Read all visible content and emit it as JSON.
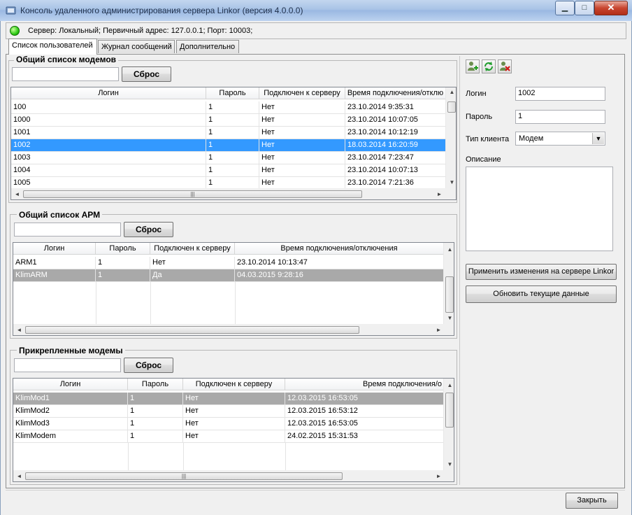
{
  "window": {
    "title": "Консоль удаленного администрирования сервера Linkor (версия 4.0.0.0)",
    "minimize": "▁",
    "maximize": "□",
    "close": "✕"
  },
  "status": {
    "text": "Сервер: Локальный; Первичный адрес: 127.0.0.1; Порт: 10003;",
    "led_color": "#2ecb16"
  },
  "tabs": [
    {
      "label": "Список пользователей",
      "active": true
    },
    {
      "label": "Журнал сообщений",
      "active": false
    },
    {
      "label": "Дополнительно",
      "active": false
    }
  ],
  "modems": {
    "title": "Общий список модемов",
    "filter_value": "",
    "reset_label": "Сброс",
    "columns": [
      "Логин",
      "Пароль",
      "Подключен к серверу",
      "Время подключения/отклю"
    ],
    "rows": [
      [
        "100",
        "1",
        "Нет",
        "23.10.2014 9:35:31"
      ],
      [
        "1000",
        "1",
        "Нет",
        "23.10.2014 10:07:05"
      ],
      [
        "1001",
        "1",
        "Нет",
        "23.10.2014 10:12:19"
      ],
      [
        "1002",
        "1",
        "Нет",
        "18.03.2014 16:20:59"
      ],
      [
        "1003",
        "1",
        "Нет",
        "23.10.2014 7:23:47"
      ],
      [
        "1004",
        "1",
        "Нет",
        "23.10.2014 10:07:13"
      ],
      [
        "1005",
        "1",
        "Нет",
        "23.10.2014 7:21:36"
      ]
    ],
    "selected_index": 3
  },
  "arm": {
    "title": "Общий список АРМ",
    "filter_value": "",
    "reset_label": "Сброс",
    "columns": [
      "Логин",
      "Пароль",
      "Подключен к серверу",
      "Время подключения/отключения"
    ],
    "rows": [
      [
        "ARM1",
        "1",
        "Нет",
        "23.10.2014 10:13:47"
      ],
      [
        "KlimARM",
        "1",
        "Да",
        "04.03.2015 9:28:16"
      ]
    ],
    "selected_index": 1
  },
  "attached": {
    "title": "Прикрепленные модемы",
    "filter_value": "",
    "reset_label": "Сброс",
    "columns": [
      "Логин",
      "Пароль",
      "Подключен к серверу",
      "Время подключения/о"
    ],
    "rows": [
      [
        "KlimMod1",
        "1",
        "Нет",
        "12.03.2015 16:53:05"
      ],
      [
        "KlimMod2",
        "1",
        "Нет",
        "12.03.2015 16:53:12"
      ],
      [
        "KlimMod3",
        "1",
        "Нет",
        "12.03.2015 16:53:05"
      ],
      [
        "KlimModem",
        "1",
        "Нет",
        "24.02.2015 15:31:53"
      ]
    ],
    "selected_index": 0
  },
  "details": {
    "icons": [
      "add-user-icon",
      "refresh-icon",
      "delete-user-icon"
    ],
    "login_label": "Логин",
    "login_value": "1002",
    "password_label": "Пароль",
    "password_value": "1",
    "client_type_label": "Тип клиента",
    "client_type_value": "Модем",
    "description_label": "Описание",
    "description_value": "",
    "apply_label": "Применить изменения на сервере Linkor",
    "refresh_label": "Обновить текущие данные"
  },
  "footer": {
    "close_label": "Закрыть"
  },
  "scroll_markers": {
    "up": "▲",
    "down": "▼",
    "left": "◄",
    "right": "►",
    "grip": "|||"
  }
}
